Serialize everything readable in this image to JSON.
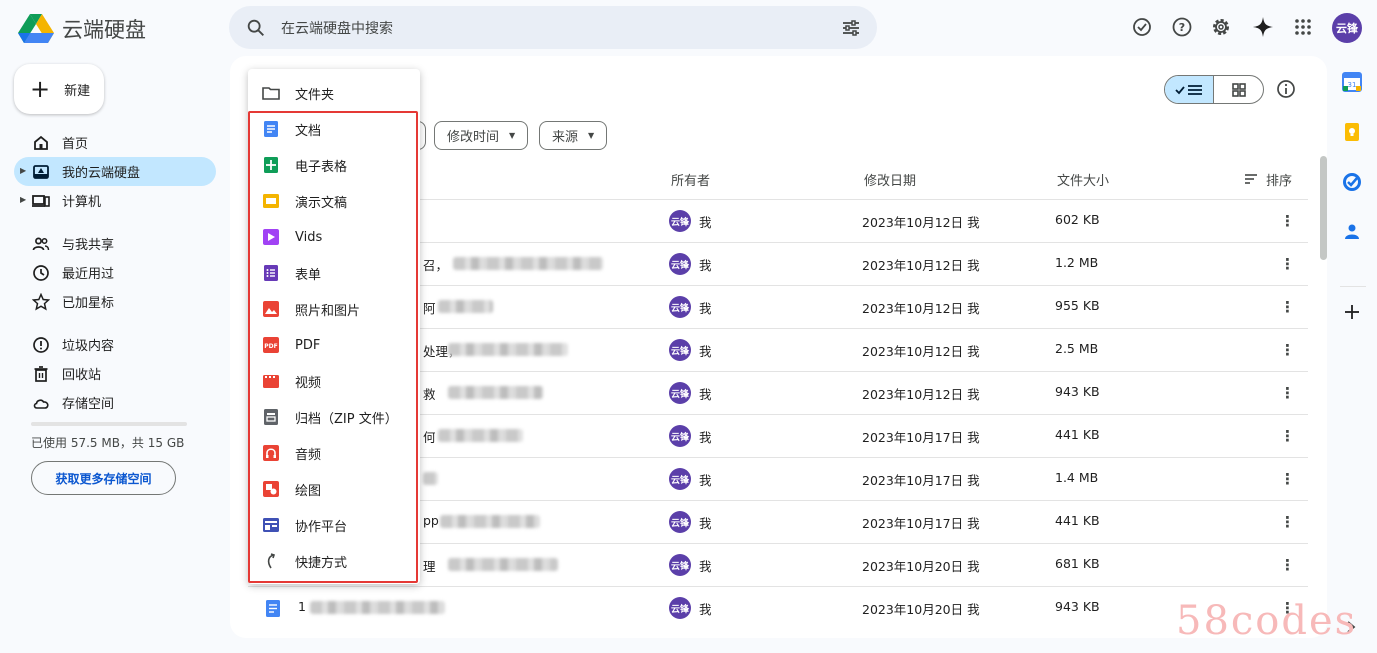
{
  "app": {
    "title": "云端硬盘",
    "avatar": "云锋"
  },
  "search": {
    "placeholder": "在云端硬盘中搜索"
  },
  "sidebar": {
    "new_label": "新建",
    "items": [
      {
        "label": "首页",
        "icon": "home-icon"
      },
      {
        "label": "我的云端硬盘",
        "icon": "drive-icon",
        "active": true
      },
      {
        "label": "计算机",
        "icon": "computer-icon"
      },
      {
        "label": "与我共享",
        "icon": "people-icon"
      },
      {
        "label": "最近用过",
        "icon": "clock-icon"
      },
      {
        "label": "已加星标",
        "icon": "star-icon"
      },
      {
        "label": "垃圾内容",
        "icon": "spam-icon"
      },
      {
        "label": "回收站",
        "icon": "trash-icon"
      },
      {
        "label": "存储空间",
        "icon": "cloud-icon"
      }
    ],
    "storage_text": "已使用 57.5 MB，共 15 GB",
    "more_storage": "获取更多存储空间"
  },
  "filters": {
    "modified": "修改时间",
    "source": "来源"
  },
  "table": {
    "headers": {
      "owner": "所有者",
      "date": "修改日期",
      "size": "文件大小",
      "sort": "排序"
    },
    "rows": [
      {
        "frag": "",
        "owner": "我",
        "date": "2023年10月12日 我",
        "size": "602 KB"
      },
      {
        "frag": "召，",
        "owner": "我",
        "date": "2023年10月12日 我",
        "size": "1.2 MB"
      },
      {
        "frag": "阿",
        "owner": "我",
        "date": "2023年10月12日 我",
        "size": "955 KB"
      },
      {
        "frag": "处理，",
        "owner": "我",
        "date": "2023年10月12日 我",
        "size": "2.5 MB"
      },
      {
        "frag": "救",
        "owner": "我",
        "date": "2023年10月12日 我",
        "size": "943 KB"
      },
      {
        "frag": "何",
        "owner": "我",
        "date": "2023年10月17日 我",
        "size": "441 KB"
      },
      {
        "frag": "",
        "owner": "我",
        "date": "2023年10月17日 我",
        "size": "1.4 MB"
      },
      {
        "frag": "pp",
        "owner": "我",
        "date": "2023年10月17日 我",
        "size": "441 KB"
      },
      {
        "frag": "理",
        "owner": "我",
        "date": "2023年10月20日 我",
        "size": "681 KB"
      },
      {
        "frag": "1",
        "owner": "我",
        "date": "2023年10月20日 我",
        "size": "943 KB"
      }
    ]
  },
  "new_menu": {
    "items": [
      {
        "label": "文件夹",
        "icon": "folder-icon"
      },
      {
        "label": "文档",
        "icon": "docs-icon",
        "color": "#4285f4"
      },
      {
        "label": "电子表格",
        "icon": "sheets-icon",
        "color": "#0f9d58"
      },
      {
        "label": "演示文稿",
        "icon": "slides-icon",
        "color": "#f4b400"
      },
      {
        "label": "Vids",
        "icon": "vids-icon",
        "color": "#a142f4"
      },
      {
        "label": "表单",
        "icon": "forms-icon",
        "color": "#673ab7"
      },
      {
        "label": "照片和图片",
        "icon": "image-icon",
        "color": "#ea4335"
      },
      {
        "label": "PDF",
        "icon": "pdf-icon",
        "color": "#ea4335"
      },
      {
        "label": "视频",
        "icon": "video-icon",
        "color": "#ea4335"
      },
      {
        "label": "归档（ZIP 文件）",
        "icon": "archive-icon",
        "color": "#5f6368"
      },
      {
        "label": "音频",
        "icon": "audio-icon",
        "color": "#ea4335"
      },
      {
        "label": "绘图",
        "icon": "drawing-icon",
        "color": "#ea4335"
      },
      {
        "label": "协作平台",
        "icon": "sites-icon",
        "color": "#3f51b5"
      },
      {
        "label": "快捷方式",
        "icon": "shortcut-icon"
      }
    ]
  },
  "watermark": "58codes"
}
